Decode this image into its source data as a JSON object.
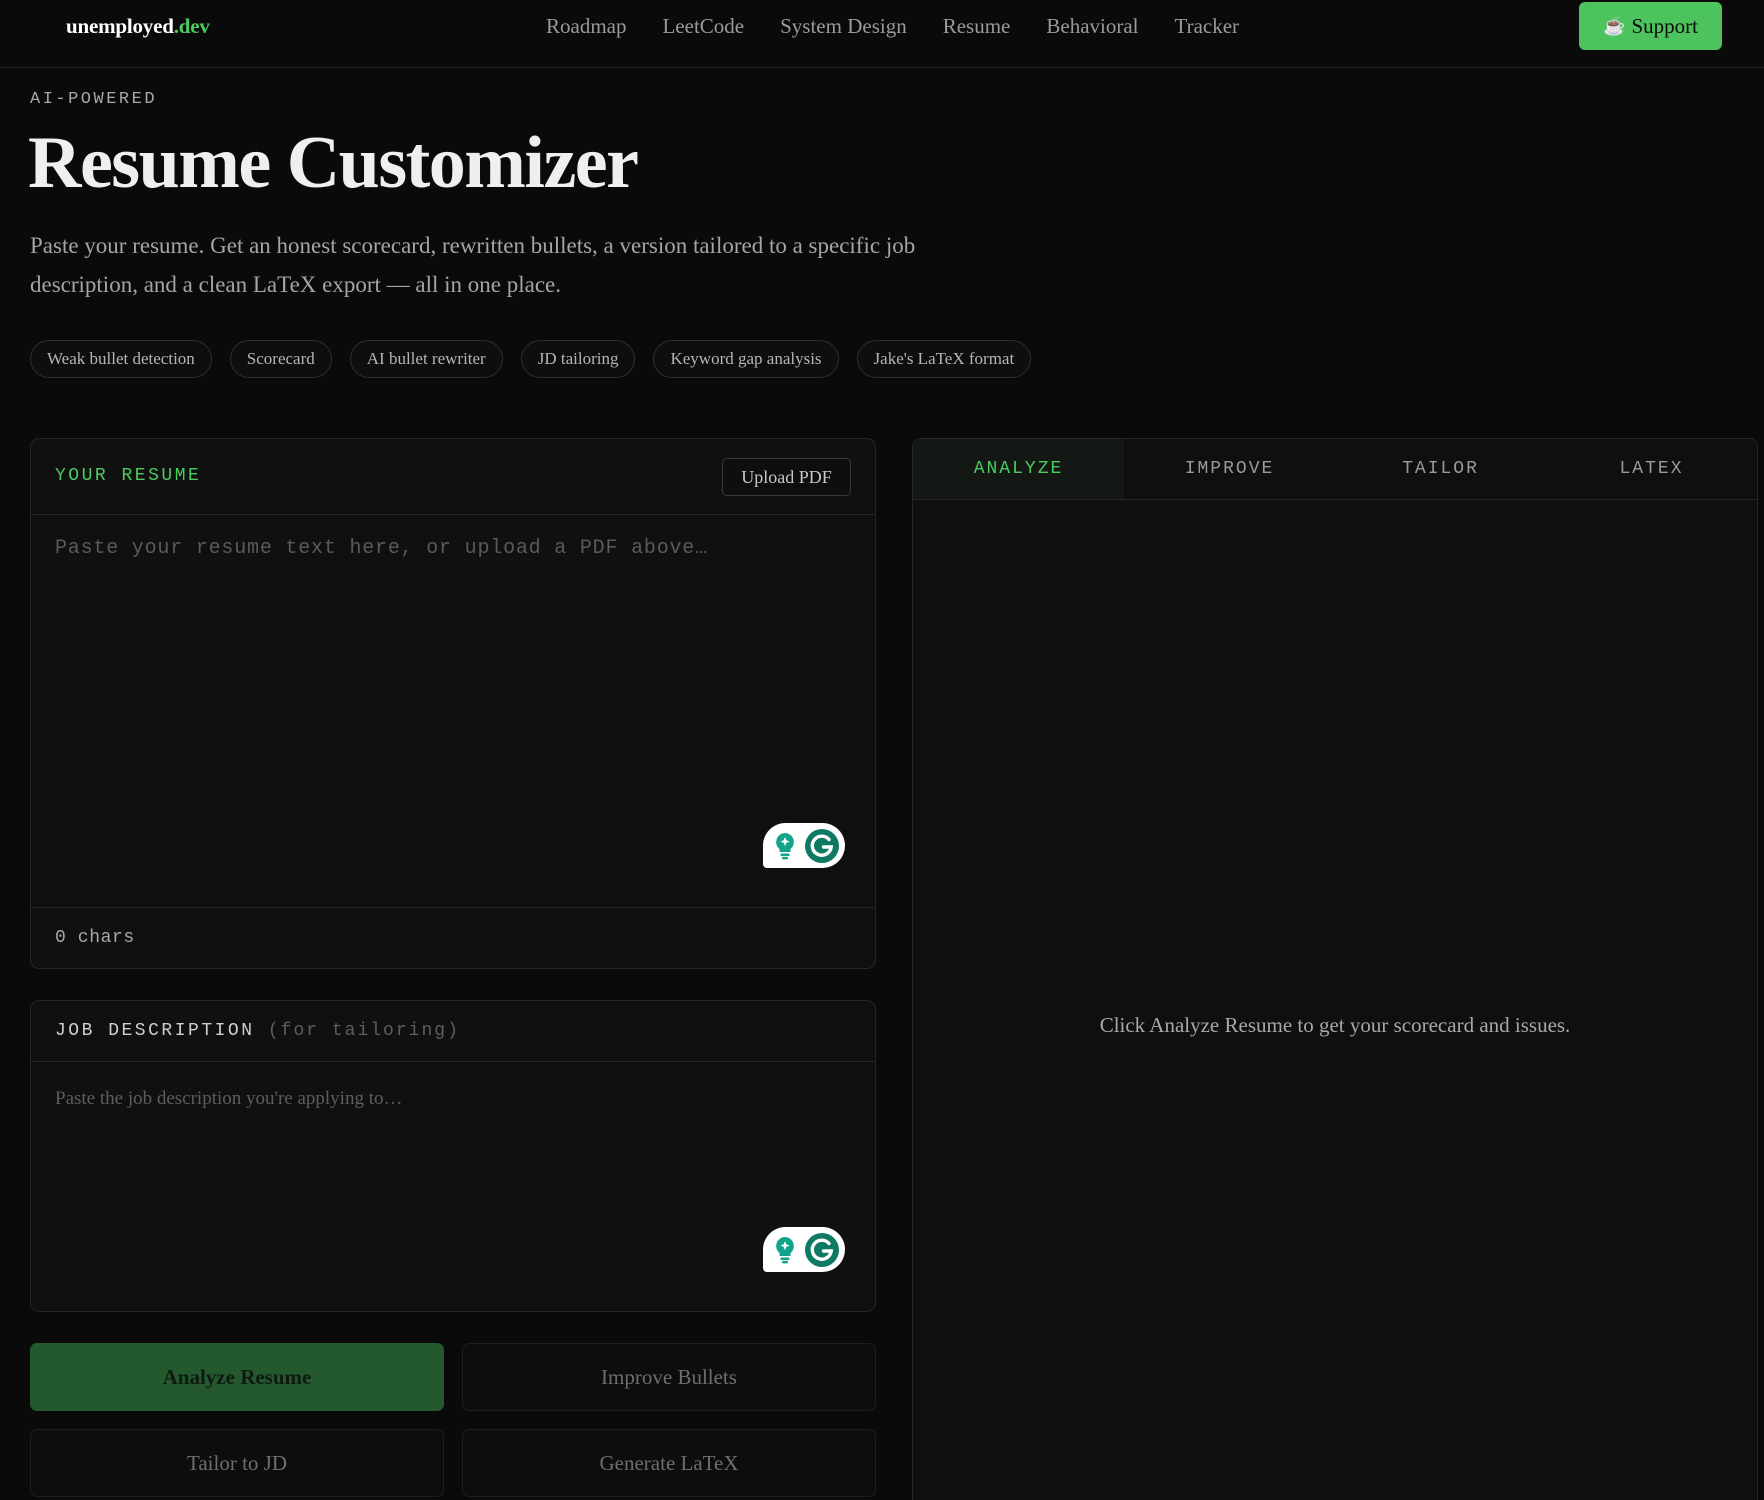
{
  "brand": {
    "name": "unemployed",
    "tld": ".dev"
  },
  "nav": {
    "links": [
      "Roadmap",
      "LeetCode",
      "System Design",
      "Resume",
      "Behavioral",
      "Tracker"
    ],
    "support_label": "Support",
    "support_icon": "coffee-cup-icon",
    "support_color": "#4cc35c"
  },
  "hero": {
    "eyebrow": "AI-POWERED",
    "title": "Resume Customizer",
    "subtitle": "Paste your resume. Get an honest scorecard, rewritten bullets, a version tailored to a specific job description, and a clean LaTeX export — all in one place.",
    "chips": [
      "Weak bullet detection",
      "Scorecard",
      "AI bullet rewriter",
      "JD tailoring",
      "Keyword gap analysis",
      "Jake's LaTeX format"
    ]
  },
  "resume": {
    "label": "YOUR RESUME",
    "upload_label": "Upload PDF",
    "value": "",
    "placeholder": "Paste your resume text here, or upload a PDF above…",
    "char_count": "0 chars"
  },
  "job_description": {
    "label": "JOB DESCRIPTION",
    "label_suffix": "(for tailoring)",
    "value": "",
    "placeholder": "Paste the job description you're applying to…"
  },
  "actions": {
    "analyze": "Analyze Resume",
    "improve": "Improve Bullets",
    "tailor": "Tailor to JD",
    "latex": "Generate LaTeX"
  },
  "output": {
    "tabs": [
      "ANALYZE",
      "IMPROVE",
      "TAILOR",
      "LATEX"
    ],
    "active_tab": "ANALYZE",
    "empty_message": "Click Analyze Resume to get your scorecard and issues."
  },
  "colors": {
    "accent": "#4ccb5f",
    "primary_button": "#24592e",
    "background": "#0a0a0a",
    "panel": "#101010"
  }
}
